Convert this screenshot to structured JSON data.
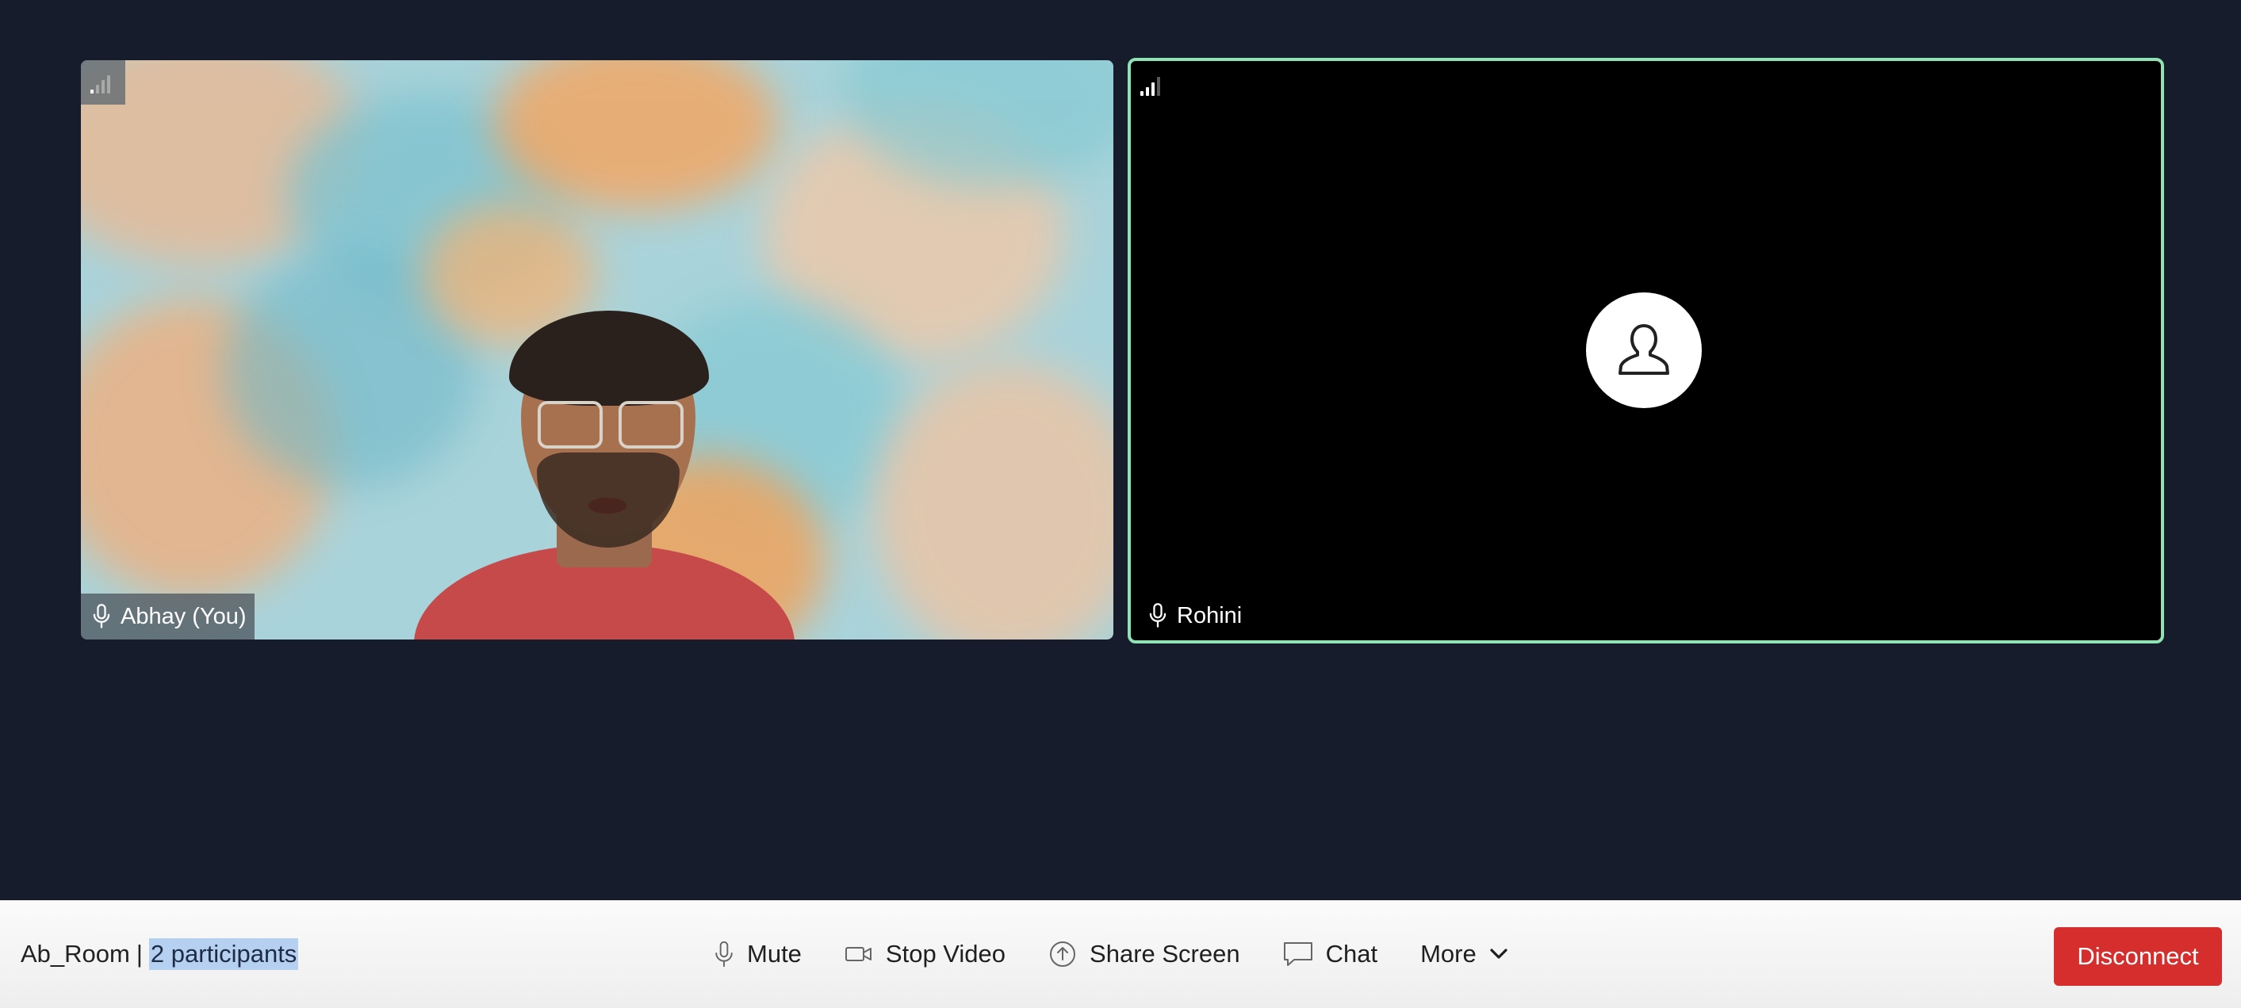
{
  "room": {
    "name": "Ab_Room",
    "separator": "|",
    "participants": "2 participants"
  },
  "tiles": [
    {
      "name": "Abhay (You)",
      "signal_icon": "signal-bars-icon",
      "mic_icon": "microphone-icon",
      "video": "camera-feed"
    },
    {
      "name": "Rohini",
      "signal_icon": "signal-bars-icon",
      "mic_icon": "microphone-icon",
      "video": "avatar-placeholder",
      "active_speaker": true
    }
  ],
  "controls": {
    "mute": "Mute",
    "stop_video": "Stop Video",
    "share_screen": "Share Screen",
    "chat": "Chat",
    "more": "More",
    "disconnect": "Disconnect"
  },
  "colors": {
    "stage_bg": "#161c2c",
    "active_border": "#8ee2b4",
    "disconnect": "#d62d2d",
    "selection_highlight": "#b6d0f2"
  }
}
